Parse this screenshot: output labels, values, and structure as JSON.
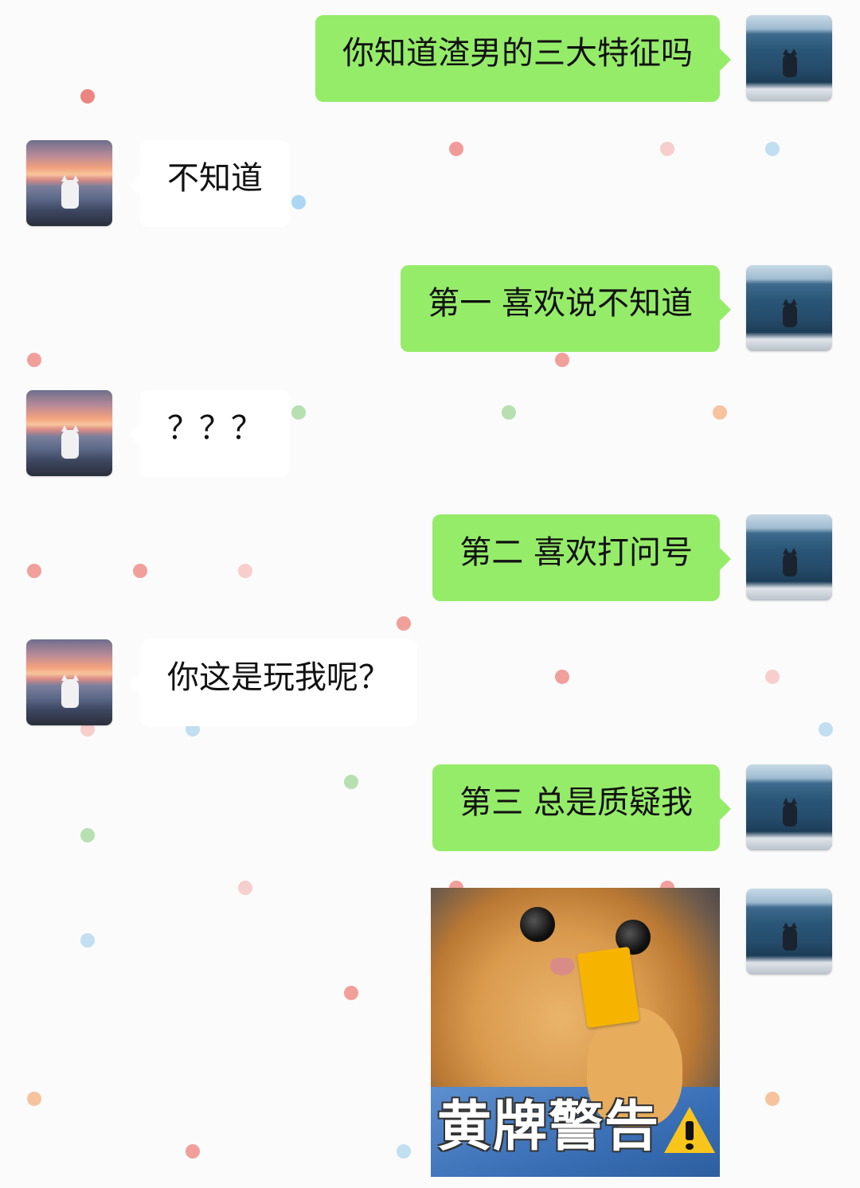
{
  "messages": [
    {
      "side": "right",
      "text": "你知道渣男的三大特征吗"
    },
    {
      "side": "left",
      "text": "不知道"
    },
    {
      "side": "right",
      "text": "第一 喜欢说不知道"
    },
    {
      "side": "left",
      "text": "？？？"
    },
    {
      "side": "right",
      "text": "第二 喜欢打问号"
    },
    {
      "side": "left",
      "text": "你这是玩我呢？"
    },
    {
      "side": "right",
      "text": "第三 总是质疑我"
    },
    {
      "side": "right",
      "type": "sticker",
      "caption": "黄牌警告"
    }
  ],
  "colors": {
    "outgoing_bubble": "#95ec69",
    "incoming_bubble": "#ffffff",
    "background": "#fbfbfb",
    "yellow_card": "#f6b400",
    "warning_icon": "#f8c51c"
  },
  "icons": {
    "right_avatar": "cat-at-sea-avatar",
    "left_avatar": "cat-at-sunset-avatar",
    "sticker_warning": "warning-icon"
  }
}
